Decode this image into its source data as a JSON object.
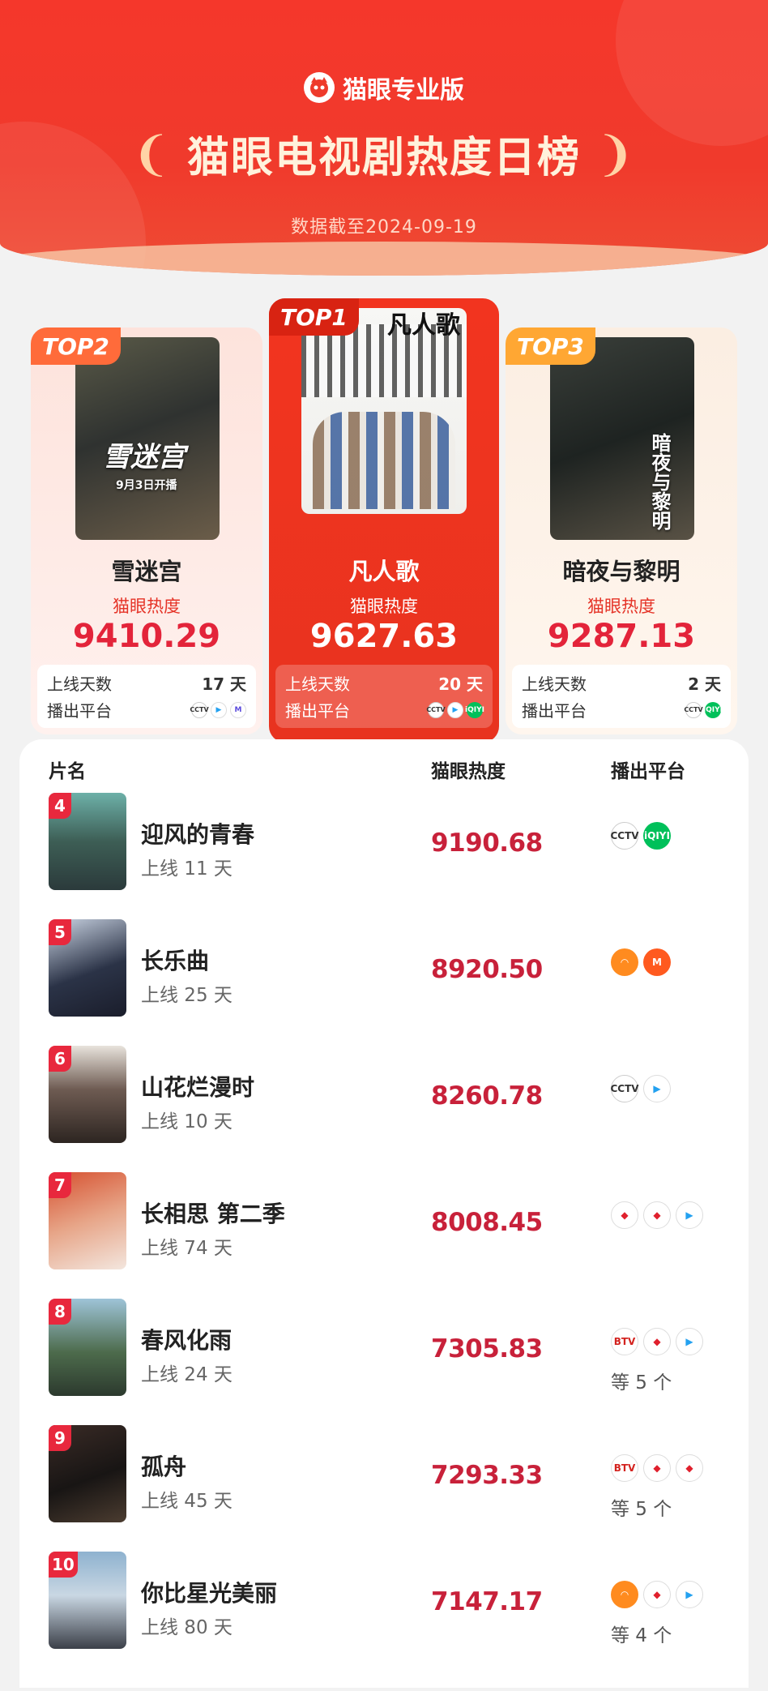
{
  "header": {
    "brand": "猫眼专业版",
    "title": "猫眼电视剧热度日榜",
    "date_line": "数据截至2024-09-19"
  },
  "top_cards": {
    "top1": {
      "rank": "TOP1",
      "title": "凡人歌",
      "metric_label": "猫眼热度",
      "score": "9627.63",
      "days_label": "上线天数",
      "days": "20 天",
      "platform_label": "播出平台",
      "poster_text": "凡人歌"
    },
    "top2": {
      "rank": "TOP2",
      "title": "雪迷宫",
      "metric_label": "猫眼热度",
      "score": "9410.29",
      "days_label": "上线天数",
      "days": "17 天",
      "platform_label": "播出平台",
      "poster_text": "雪迷宫",
      "poster_sub": "9月3日开播"
    },
    "top3": {
      "rank": "TOP3",
      "title": "暗夜与黎明",
      "metric_label": "猫眼热度",
      "score": "9287.13",
      "days_label": "上线天数",
      "days": "2 天",
      "platform_label": "播出平台",
      "poster_text": "暗夜与黎明"
    }
  },
  "list": {
    "col_title": "片名",
    "col_score": "猫眼热度",
    "col_platform": "播出平台",
    "rows": [
      {
        "rank": "4",
        "title": "迎风的青春",
        "days": "上线 11 天",
        "score": "9190.68",
        "more": ""
      },
      {
        "rank": "5",
        "title": "长乐曲",
        "days": "上线 25 天",
        "score": "8920.50",
        "more": ""
      },
      {
        "rank": "6",
        "title": "山花烂漫时",
        "days": "上线 10 天",
        "score": "8260.78",
        "more": ""
      },
      {
        "rank": "7",
        "title": "长相思 第二季",
        "days": "上线 74 天",
        "score": "8008.45",
        "more": ""
      },
      {
        "rank": "8",
        "title": "春风化雨",
        "days": "上线 24 天",
        "score": "7305.83",
        "more": "等 5 个"
      },
      {
        "rank": "9",
        "title": "孤舟",
        "days": "上线 45 天",
        "score": "7293.33",
        "more": "等 5 个"
      },
      {
        "rank": "10",
        "title": "你比星光美丽",
        "days": "上线 80 天",
        "score": "7147.17",
        "more": "等 4 个"
      }
    ]
  },
  "icons": {
    "cctv": "CCTV",
    "iqiyi": "iQIYI",
    "tencent": "▶",
    "youku": "▶",
    "mgtv": "M",
    "mango": "◠",
    "btv": "BTV",
    "red": "◆",
    "mytv": "M"
  },
  "colors": {
    "brand_red": "#f03a2c",
    "score_red": "#c8213a",
    "top2_tag": "#ff6b3a",
    "top3_tag": "#ffa733"
  }
}
